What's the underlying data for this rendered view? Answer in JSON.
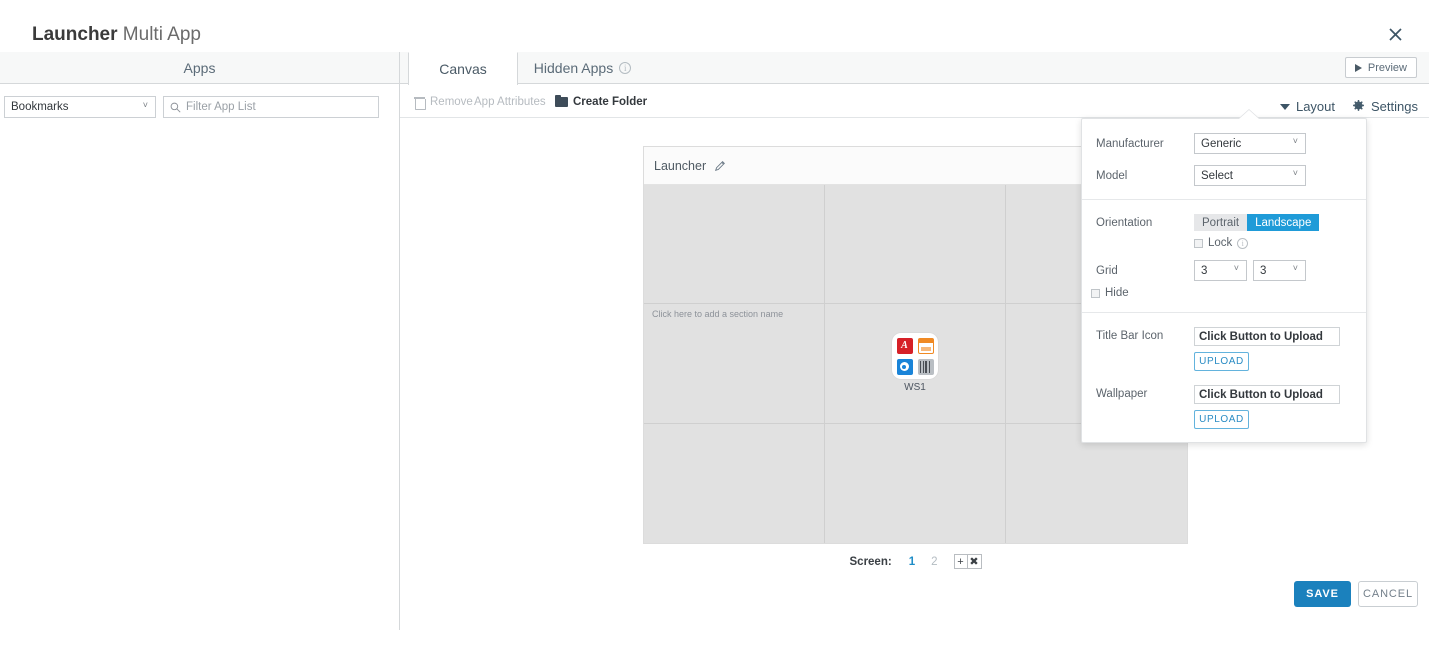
{
  "window": {
    "title_bold": "Launcher",
    "title_light": " Multi App",
    "close_icon": "close-icon"
  },
  "left_panel": {
    "tab_label": "Apps",
    "source_select": {
      "value": "Bookmarks",
      "caret": "˅"
    },
    "filter": {
      "placeholder": "Filter App List",
      "value": "",
      "icon": "search-icon"
    }
  },
  "main": {
    "tabs": [
      {
        "label": "Canvas",
        "active": true
      },
      {
        "label": "Hidden Apps",
        "active": false,
        "info_icon": "info-icon"
      }
    ],
    "preview_button": {
      "label": "Preview",
      "icon": "play-icon"
    },
    "actions": [
      {
        "label": "Remove",
        "enabled": false,
        "icon": "trash-icon"
      },
      {
        "label": "App Attributes",
        "enabled": false
      },
      {
        "label": "Create Folder",
        "enabled": true,
        "icon": "folder-icon"
      }
    ],
    "layout_link": {
      "label": "Layout",
      "icon": "chevron-down-icon"
    },
    "settings_link": {
      "label": "Settings",
      "icon": "gear-icon"
    }
  },
  "canvas": {
    "device_title": "Launcher",
    "edit_icon": "pencil-icon",
    "grid_rows": 3,
    "grid_cols": 3,
    "section_placeholder": "Click here to add a section name",
    "app_group": {
      "label": "WS1",
      "icons": [
        {
          "name": "acrobat-icon",
          "color": "#d62027"
        },
        {
          "name": "window-folder-icon",
          "color": "#f08a24"
        },
        {
          "name": "outlook-icon",
          "color": "#1a84d8"
        },
        {
          "name": "barcode-icon",
          "color": "#8d9299"
        }
      ]
    },
    "screen_bar": {
      "label": "Screen:",
      "pages": [
        {
          "num": "1",
          "active": true
        },
        {
          "num": "2",
          "active": false
        }
      ],
      "add_button": "+",
      "delete_button": "✖"
    }
  },
  "layout_popover": {
    "manufacturer": {
      "label": "Manufacturer",
      "value": "Generic",
      "caret": "˅"
    },
    "model": {
      "label": "Model",
      "value": "Select",
      "caret": "˅"
    },
    "orientation": {
      "label": "Orientation",
      "options": [
        {
          "label": "Portrait",
          "selected": false
        },
        {
          "label": "Landscape",
          "selected": true
        }
      ],
      "lock": {
        "label": "Lock",
        "checked": false,
        "info_icon": "info-icon"
      }
    },
    "grid": {
      "label": "Grid",
      "rows_value": "3",
      "cols_value": "3",
      "caret": "˅",
      "hide": {
        "label": "Hide",
        "checked": false
      }
    },
    "title_bar_icon": {
      "label": "Title Bar Icon",
      "field_value": "Click Button to Upload",
      "button_label": "UPLOAD"
    },
    "wallpaper": {
      "label": "Wallpaper",
      "field_value": "Click Button to Upload",
      "button_label": "UPLOAD"
    }
  },
  "footer": {
    "save_label": "SAVE",
    "cancel_label": "CANCEL"
  },
  "colors": {
    "accent_blue": "#1f9bd8",
    "save_blue": "#1b81bd",
    "link_blue": "#1f8dc7",
    "text_dark": "#33383d",
    "text_muted": "#8d9299"
  }
}
